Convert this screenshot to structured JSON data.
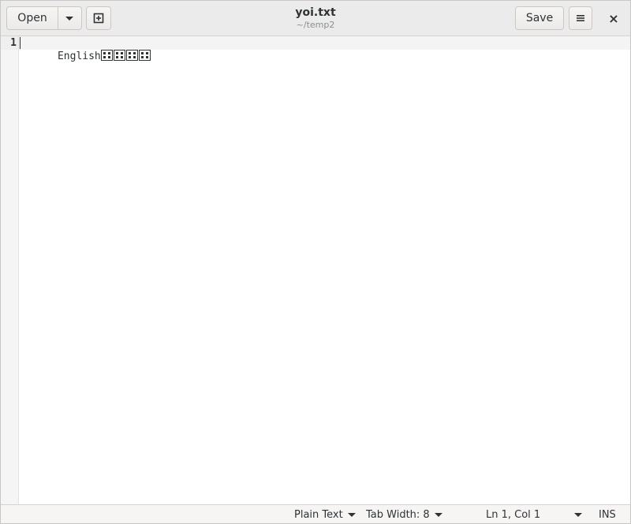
{
  "header": {
    "open_label": "Open",
    "save_label": "Save",
    "title": "yoi.txt",
    "subtitle": "~/temp2",
    "close_glyph": "×",
    "menu_glyph": "≡",
    "new_tab_glyph": "⊞"
  },
  "icons": {
    "open_menu": "chevron-down-icon",
    "new_tab": "new-document-icon",
    "menu": "hamburger-menu-icon",
    "close": "close-icon"
  },
  "editor": {
    "lines": [
      {
        "number": "1",
        "text": "English"
      }
    ],
    "missing_glyph_boxes": 4,
    "current_line": 1
  },
  "statusbar": {
    "language": "Plain Text",
    "tab_width": "Tab Width: 8",
    "position": "Ln 1, Col 1",
    "mode": "INS"
  }
}
